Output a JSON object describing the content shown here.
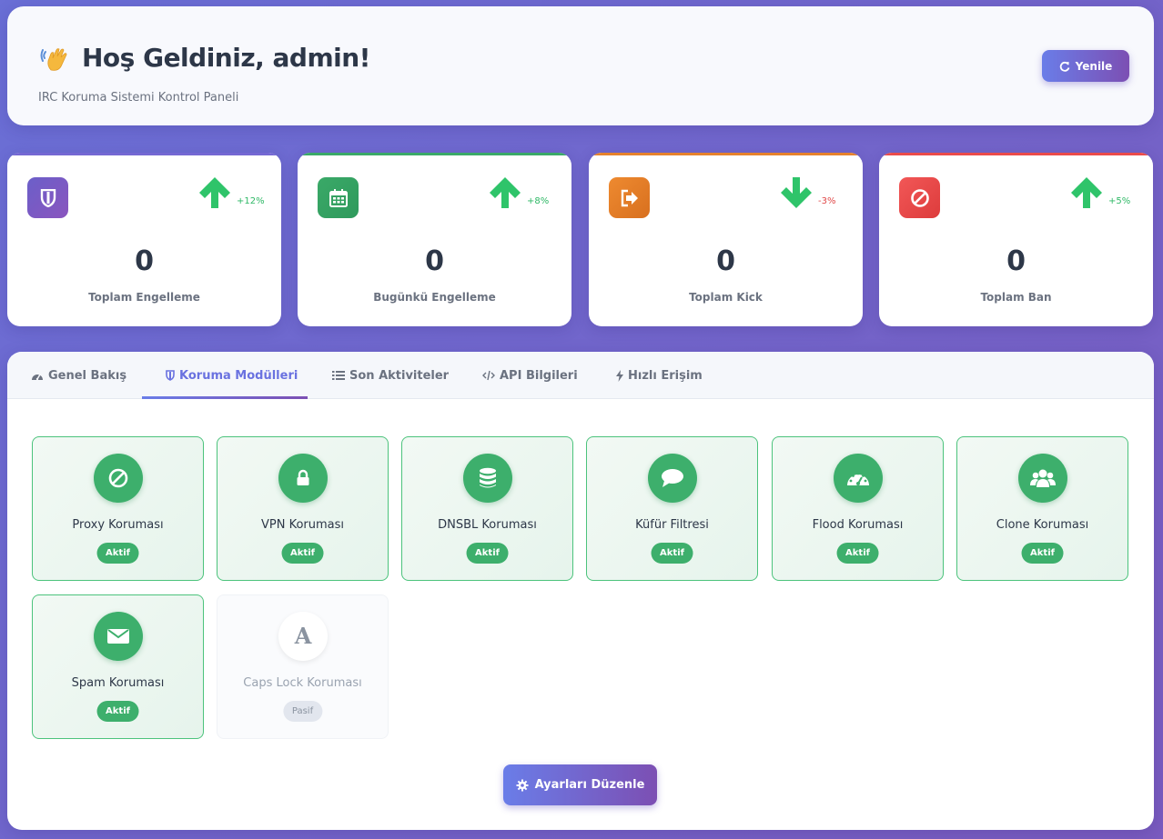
{
  "header": {
    "title": "Hoş Geldiniz, admin!",
    "subtitle": "IRC Koruma Sistemi Kontrol Paneli",
    "refresh_label": "Yenile",
    "wave_icon": "waving-hand-emoji"
  },
  "stats": [
    {
      "value": "0",
      "label": "Toplam Engelleme",
      "change": "+12%",
      "trend": "up",
      "icon": "shield-icon",
      "color": "#6b5fc9"
    },
    {
      "value": "0",
      "label": "Bugünkü Engelleme",
      "change": "+8%",
      "trend": "up",
      "icon": "calendar-icon",
      "color": "#3aa968"
    },
    {
      "value": "0",
      "label": "Toplam Kick",
      "change": "-3%",
      "trend": "down",
      "icon": "sign-out-icon",
      "color": "#e6822d"
    },
    {
      "value": "0",
      "label": "Toplam Ban",
      "change": "+5%",
      "trend": "up",
      "icon": "ban-icon",
      "color": "#ea4b4b"
    }
  ],
  "tabs": [
    {
      "label": "Genel Bakış",
      "icon": "dashboard-icon",
      "active": false
    },
    {
      "label": "Koruma Modülleri",
      "icon": "shield-icon",
      "active": true
    },
    {
      "label": "Son Aktiviteler",
      "icon": "list-icon",
      "active": false
    },
    {
      "label": "API Bilgileri",
      "icon": "code-icon",
      "active": false
    },
    {
      "label": "Hızlı Erişim",
      "icon": "bolt-icon",
      "active": false
    }
  ],
  "modules": [
    {
      "name": "Proxy Koruması",
      "status": "Aktif",
      "icon": "ban-icon"
    },
    {
      "name": "VPN Koruması",
      "status": "Aktif",
      "icon": "lock-icon"
    },
    {
      "name": "DNSBL Koruması",
      "status": "Aktif",
      "icon": "database-icon"
    },
    {
      "name": "Küfür Filtresi",
      "status": "Aktif",
      "icon": "comment-icon"
    },
    {
      "name": "Flood Koruması",
      "status": "Aktif",
      "icon": "tachometer-icon"
    },
    {
      "name": "Clone Koruması",
      "status": "Aktif",
      "icon": "users-icon"
    },
    {
      "name": "Spam Koruması",
      "status": "Aktif",
      "icon": "envelope-icon"
    },
    {
      "name": "Caps Lock Koruması",
      "status": "Pasif",
      "icon": "font-a-icon"
    }
  ],
  "edit_button": {
    "label": "Ayarları Düzenle",
    "icon": "gear-icon"
  },
  "colors": {
    "accent_start": "#6a7de8",
    "accent_end": "#7c4fb3",
    "active_green": "#3daf6c",
    "up": "#2fc46a",
    "down": "#e04848"
  }
}
